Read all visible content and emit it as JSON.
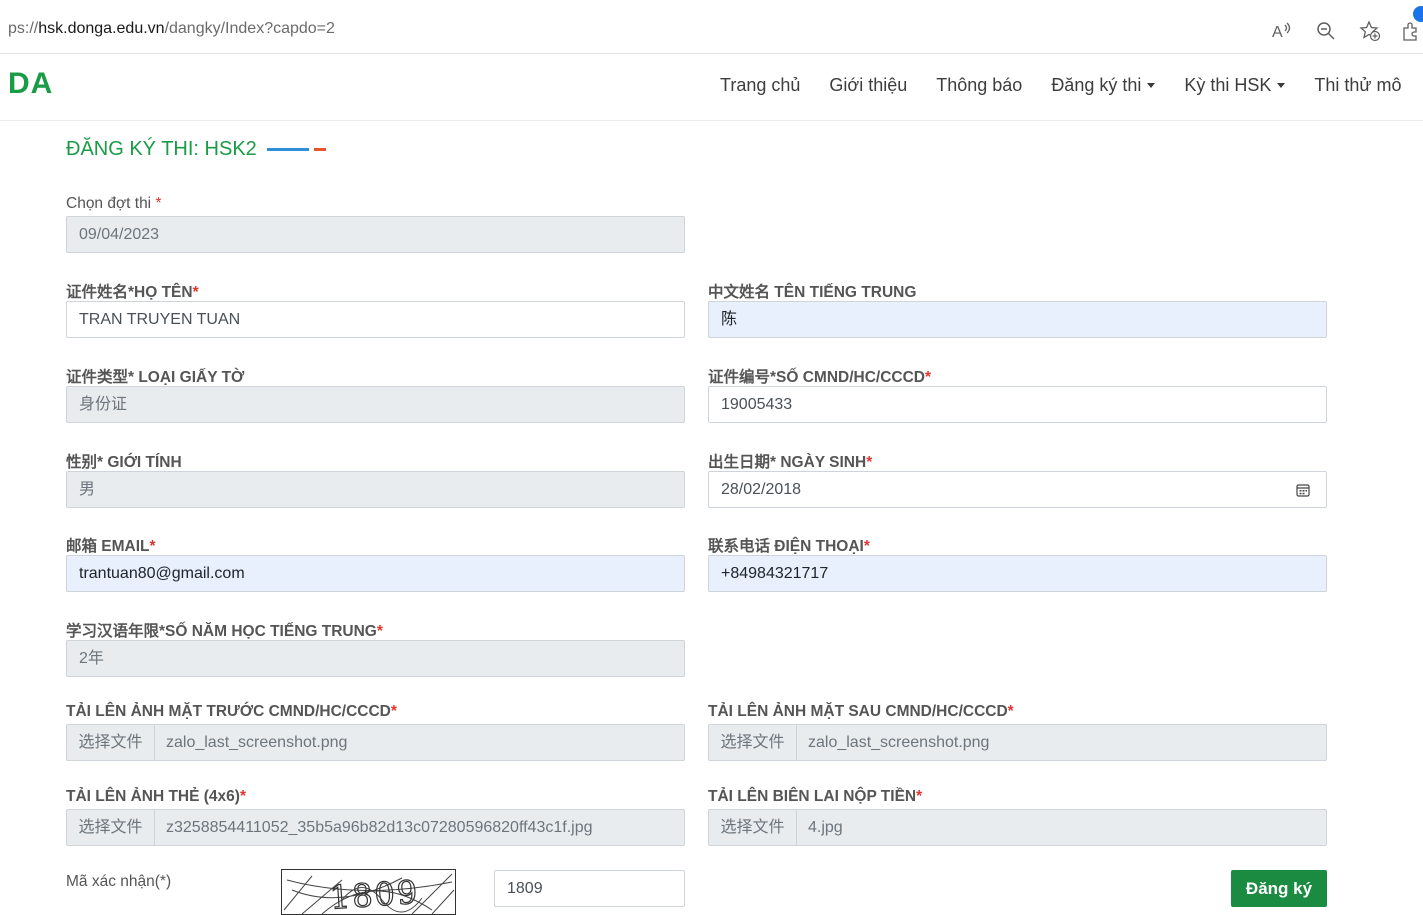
{
  "browser": {
    "url_prefix": "ps://",
    "url_host": "hsk.donga.edu.vn",
    "url_path": "/dangky/Index?capdo=2",
    "icons": [
      "read-aloud-icon",
      "zoom-out-icon",
      "favorites-icon",
      "extensions-icon"
    ]
  },
  "site": {
    "logo": "DA",
    "nav": [
      {
        "label": "Trang chủ"
      },
      {
        "label": "Giới thiệu"
      },
      {
        "label": "Thông báo"
      },
      {
        "label": "Đăng ký thi"
      },
      {
        "label": "Kỳ thi HSK"
      },
      {
        "label": "Thi thử mô"
      }
    ]
  },
  "form": {
    "heading": "ĐĂNG KÝ THI: HSK2",
    "required_mark": "*",
    "exam_date": {
      "label": "Chọn đợt thi ",
      "value": "09/04/2023"
    },
    "full_name": {
      "label": "证件姓名*HỌ TÊN",
      "value": "TRAN TRUYEN TUAN"
    },
    "chinese_name": {
      "label": "中文姓名 TÊN TIẾNG TRUNG",
      "value": "陈"
    },
    "id_type": {
      "label": "证件类型* LOẠI GIẤY TỜ",
      "value": "身份证"
    },
    "id_number": {
      "label": "证件编号*SỐ CMND/HC/CCCD",
      "value": "19005433"
    },
    "gender": {
      "label": "性别* GIỚI TÍNH",
      "value": "男"
    },
    "birth_date": {
      "label": "出生日期* NGÀY SINH",
      "value": "28/02/2018"
    },
    "email": {
      "label": "邮箱 EMAIL",
      "value": "trantuan80@gmail.com"
    },
    "phone": {
      "label": "联系电话 ĐIỆN THOẠI",
      "value": "+84984321717"
    },
    "study_years": {
      "label": "学习汉语年限*SỐ NĂM HỌC TIẾNG TRUNG",
      "value": "2年"
    },
    "upload_front": {
      "label": "TẢI LÊN ẢNH MẶT TRƯỚC CMND/HC/CCCD",
      "button": "选择文件",
      "file": "zalo_last_screenshot.png"
    },
    "upload_back": {
      "label": "TẢI LÊN ẢNH MẶT SAU CMND/HC/CCCD",
      "button": "选择文件",
      "file": "zalo_last_screenshot.png"
    },
    "upload_photo": {
      "label": "TẢI LÊN ẢNH THẺ (4x6)",
      "button": "选择文件",
      "file": "z3258854411052_35b5a96b82d13c07280596820ff43c1f.jpg"
    },
    "upload_receipt": {
      "label": "TẢI LÊN BIÊN LAI NỘP TIỀN",
      "button": "选择文件",
      "file": "4.jpg"
    },
    "captcha": {
      "label": "Mã xác nhận(*)",
      "image_text": "1809",
      "value": "1809"
    },
    "submit_label": "Đăng ký"
  },
  "colors": {
    "brand_green": "#1a9b46",
    "submit_green": "#1a8b40",
    "required_red": "#e3342f",
    "autofill_blue": "#e8f0fe",
    "readonly_gray": "#e9ecef"
  }
}
